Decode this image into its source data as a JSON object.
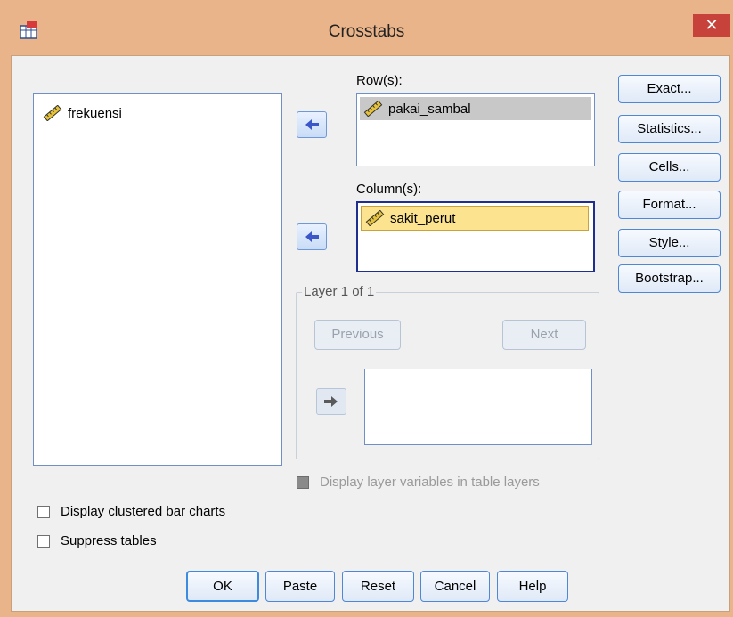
{
  "window": {
    "title": "Crosstabs",
    "close_glyph": "✕",
    "app_icon": "spss-table-icon"
  },
  "source_list": {
    "items": [
      {
        "label": "frekuensi",
        "icon": "ruler-scale-icon"
      }
    ]
  },
  "rows": {
    "label": "Row(s):",
    "items": [
      {
        "label": "pakai_sambal",
        "icon": "ruler-scale-icon"
      }
    ]
  },
  "columns": {
    "label": "Column(s):",
    "items": [
      {
        "label": "sakit_perut",
        "icon": "ruler-scale-icon"
      }
    ]
  },
  "layer": {
    "title": "Layer 1 of 1",
    "previous_label": "Previous",
    "next_label": "Next"
  },
  "right_buttons": {
    "exact": "Exact...",
    "statistics": "Statistics...",
    "cells": "Cells...",
    "format": "Format...",
    "style": "Style...",
    "bootstrap": "Bootstrap..."
  },
  "options": {
    "display_layer_vars": "Display layer variables in table layers",
    "clustered_bar_charts": "Display clustered bar charts",
    "suppress_tables": "Suppress tables"
  },
  "bottom_buttons": {
    "ok": "OK",
    "paste": "Paste",
    "reset": "Reset",
    "cancel": "Cancel",
    "help": "Help"
  },
  "colors": {
    "title_bar": "#e9b48a",
    "close_button": "#c7423a",
    "selected_item": "#c8c8c8",
    "highlight_item": "#fbe38f",
    "arrow": "#3a56c8"
  }
}
